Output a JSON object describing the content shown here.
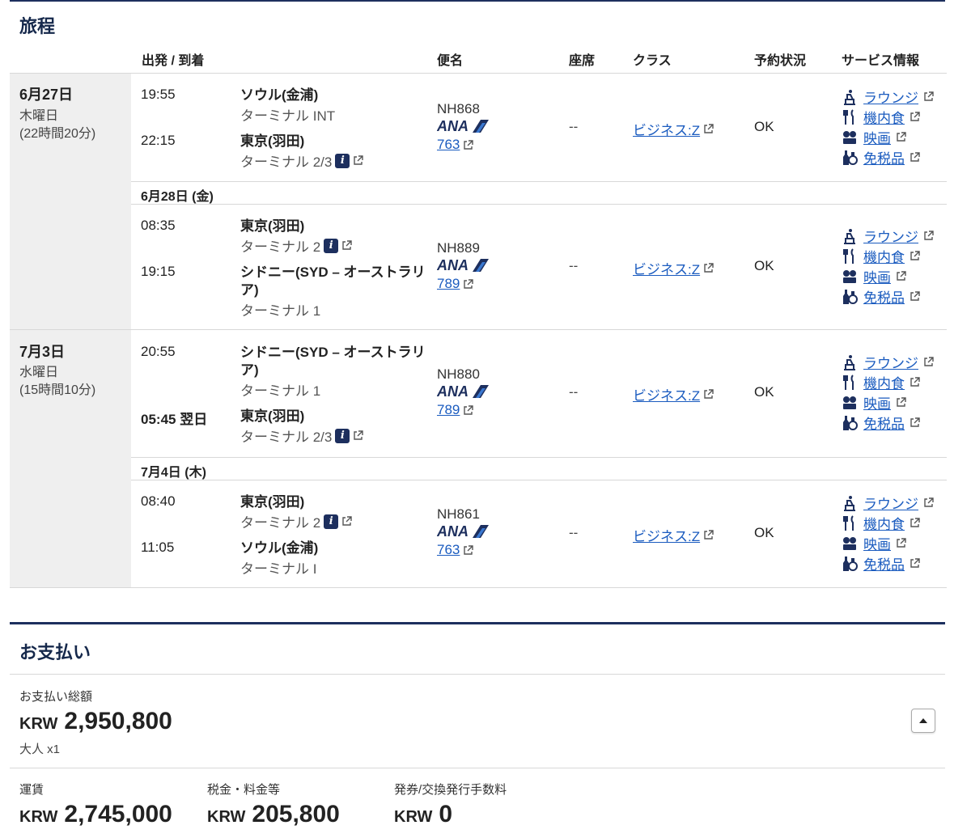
{
  "itinerary": {
    "title": "旅程",
    "headers": {
      "dep_arr": "出発 / 到着",
      "flight": "便名",
      "seat": "座席",
      "class": "クラス",
      "status": "予約状況",
      "service": "サービス情報"
    },
    "journeys": [
      {
        "date": "6月27日",
        "weekday": "木曜日",
        "duration": "(22時間20分)",
        "connection_date": "6月28日 (金)",
        "segments": [
          {
            "dep_time": "19:55",
            "dep_city": "ソウル(金浦)",
            "dep_terminal": "ターミナル INT",
            "arr_time": "22:15",
            "arr_city": "東京(羽田)",
            "arr_terminal": "ターミナル 2/3",
            "flight_no": "NH868",
            "equipment": "763",
            "seat": "--",
            "class": "ビジネス:Z",
            "status": "OK"
          },
          {
            "dep_time": "08:35",
            "dep_city": "東京(羽田)",
            "dep_terminal": "ターミナル 2",
            "arr_time": "19:15",
            "arr_city": "シドニー(SYD – オーストラリア)",
            "arr_terminal": "ターミナル 1",
            "flight_no": "NH889",
            "equipment": "789",
            "seat": "--",
            "class": "ビジネス:Z",
            "status": "OK"
          }
        ]
      },
      {
        "date": "7月3日",
        "weekday": "水曜日",
        "duration": "(15時間10分)",
        "connection_date": "7月4日 (木)",
        "segments": [
          {
            "dep_time": "20:55",
            "dep_city": "シドニー(SYD – オーストラリア)",
            "dep_terminal": "ターミナル 1",
            "arr_time": "05:45",
            "arr_next_day": "翌日",
            "arr_city": "東京(羽田)",
            "arr_terminal": "ターミナル 2/3",
            "flight_no": "NH880",
            "equipment": "789",
            "seat": "--",
            "class": "ビジネス:Z",
            "status": "OK"
          },
          {
            "dep_time": "08:40",
            "dep_city": "東京(羽田)",
            "dep_terminal": "ターミナル 2",
            "arr_time": "11:05",
            "arr_city": "ソウル(金浦)",
            "arr_terminal": "ターミナル I",
            "flight_no": "NH861",
            "equipment": "763",
            "seat": "--",
            "class": "ビジネス:Z",
            "status": "OK"
          }
        ]
      }
    ],
    "airline_logo_text": "ANA",
    "services": [
      "ラウンジ",
      "機内食",
      "映画",
      "免税品"
    ],
    "service_icons": [
      "lounge-icon",
      "meal-icon",
      "movie-icon",
      "duty-free-icon"
    ]
  },
  "payment": {
    "title": "お支払い",
    "total_label": "お支払い総額",
    "total_currency": "KRW",
    "total_amount": "2,950,800",
    "passengers": "大人 x1",
    "fare_label": "運賃",
    "fare_currency": "KRW",
    "fare_amount": "2,745,000",
    "tax_label": "税金・料金等",
    "tax_currency": "KRW",
    "tax_amount": "205,800",
    "fee_label": "発券/交換発行手数料",
    "fee_currency": "KRW",
    "fee_amount": "0"
  },
  "colors": {
    "navy": "#1d2f5e",
    "link": "#1a5bbf",
    "day_bg": "#efefef"
  }
}
